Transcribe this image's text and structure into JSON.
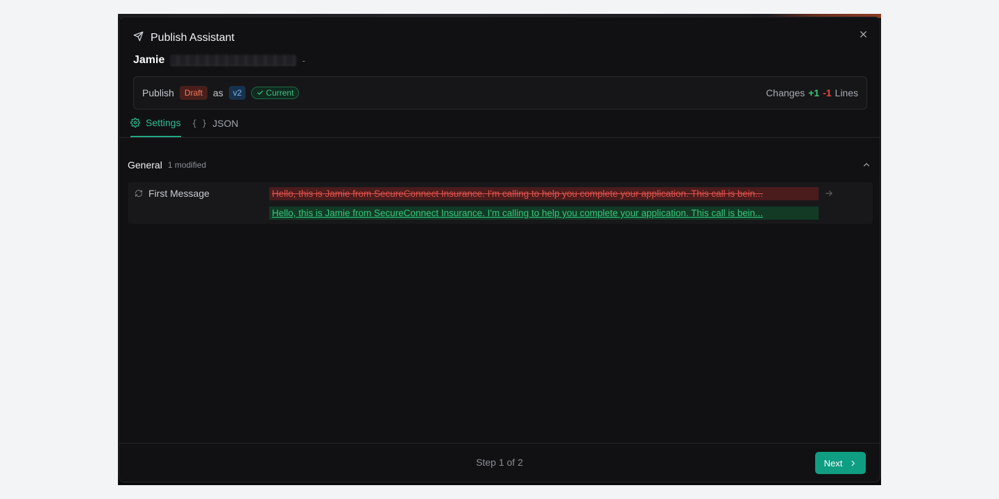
{
  "modal": {
    "title": "Publish Assistant",
    "close_icon": "close-icon",
    "title_icon": "send-icon"
  },
  "agent": {
    "name": "Jamie",
    "dash": "-"
  },
  "publish": {
    "label": "Publish",
    "status_badge": "Draft",
    "as_label": "as",
    "version_badge": "v2",
    "current_badge": "Current",
    "changes_label": "Changes",
    "added": "+1",
    "removed": "-1",
    "lines_label": "Lines"
  },
  "tabs": [
    {
      "label": "Settings",
      "icon": "gear-icon",
      "active": true
    },
    {
      "label": "JSON",
      "icon": "braces-icon",
      "active": false
    }
  ],
  "section": {
    "title": "General",
    "subtitle": "1 modified"
  },
  "diff": {
    "field_label": "First Message",
    "field_icon": "refresh-icon",
    "old_value": "Hello, this is Jamie from SecureConnect Insurance. I'm calling to help you complete your application. This call is bein...",
    "new_value": "Hello, this is Jamie from SecureConnect Insurance. I'm calling to help you complete your application. This call is bein..."
  },
  "footer": {
    "step_text": "Step 1 of 2",
    "next_label": "Next"
  },
  "colors": {
    "accent": "#109e83",
    "added": "#34c77b",
    "removed": "#ef4444",
    "draft": "#f4795b",
    "version": "#7fb3e6"
  }
}
